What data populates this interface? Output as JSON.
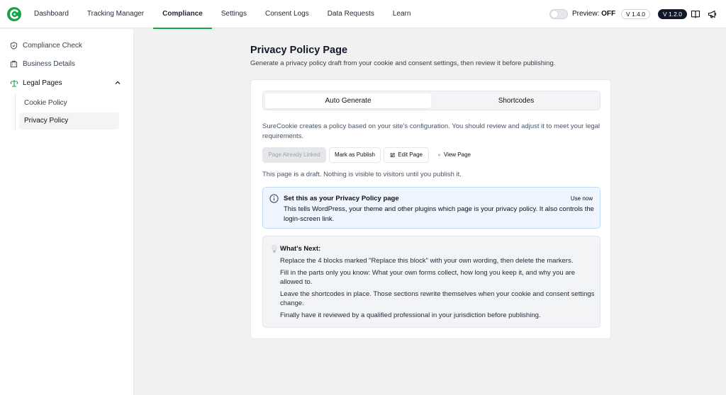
{
  "topbar": {
    "nav": [
      "Dashboard",
      "Tracking Manager",
      "Compliance",
      "Settings",
      "Consent Logs",
      "Data Requests",
      "Learn"
    ],
    "active_nav": "Compliance",
    "preview_label": "Preview:",
    "preview_value": "OFF",
    "version_left": "V 1.4.0",
    "version_right": "V 1.2.0",
    "brand_color": "#16a34a"
  },
  "sidebar": {
    "items": [
      {
        "label": "Compliance Check",
        "icon": "shield-icon"
      },
      {
        "label": "Business Details",
        "icon": "building-icon"
      }
    ],
    "group": {
      "label": "Legal Pages",
      "icon": "scale-icon",
      "expanded": true
    },
    "sub_items": [
      "Cookie Policy",
      "Privacy Policy"
    ],
    "active_sub": "Privacy Policy"
  },
  "main": {
    "title": "Privacy Policy Page",
    "subtitle": "Generate a privacy policy draft from your cookie and consent settings, then review it before publishing.",
    "tabs": [
      "Auto Generate",
      "Shortcodes"
    ],
    "active_tab": "Auto Generate",
    "description": "SureCookie creates a policy based on your site's configuration. You should review and adjust it to meet your legal requirements.",
    "buttons": {
      "linked": "Page Already Linked",
      "publish": "Mark as Publish",
      "edit": "Edit Page",
      "view": "View Page"
    },
    "draft_note": "This page is a draft. Nothing is visible to visitors until you publish it.",
    "info": {
      "title": "Set this as your Privacy Policy page",
      "action": "Use now",
      "text": "This tells WordPress, your theme and other plugins which page is your privacy policy. It also controls the login-screen link."
    },
    "next": {
      "title": "What's Next:",
      "items": [
        "Replace the 4 blocks marked \"Replace this block\" with your own wording, then delete the markers.",
        "Fill in the parts only you know: What your own forms collect, how long you keep it, and why you are allowed to.",
        "Leave the shortcodes in place. Those sections rewrite themselves when your cookie and consent settings change.",
        "Finally have it reviewed by a qualified professional in your jurisdiction before publishing."
      ]
    }
  }
}
